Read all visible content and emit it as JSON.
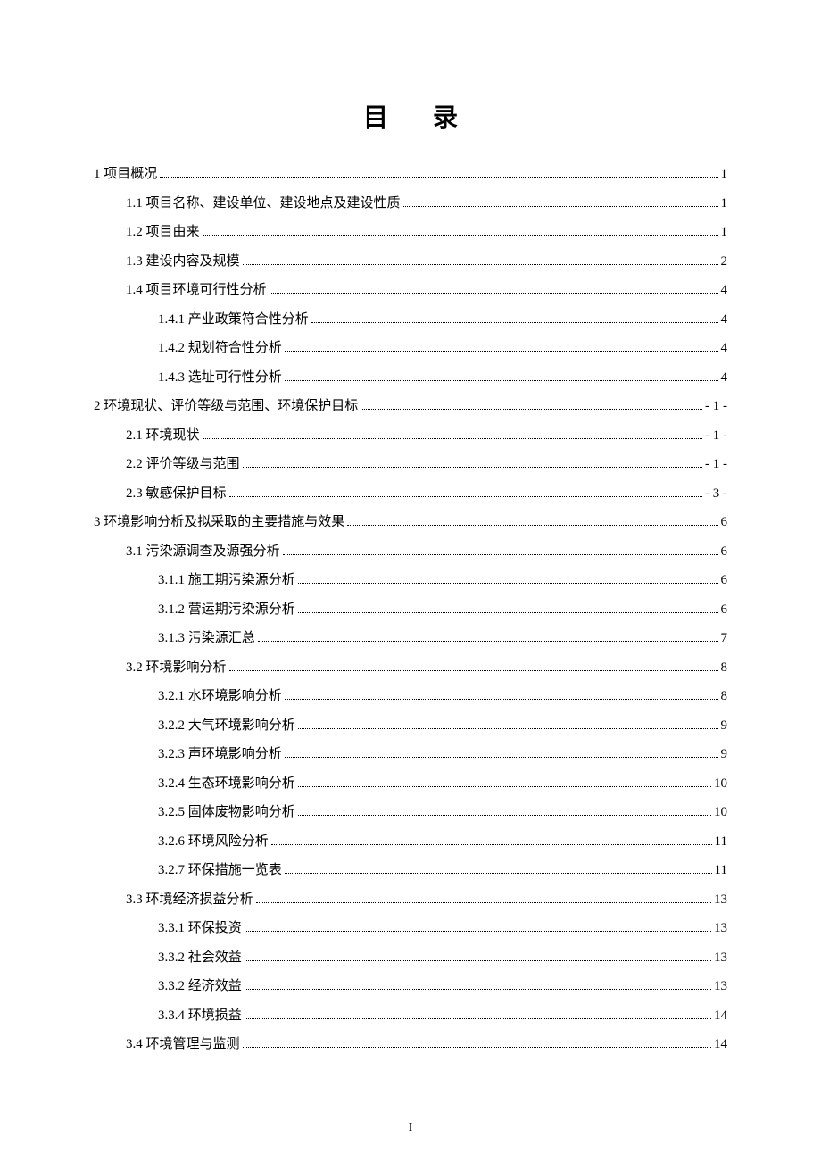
{
  "title": "目录",
  "footer_page": "I",
  "toc": [
    {
      "level": 0,
      "label": "1   项目概况",
      "page": "1"
    },
    {
      "level": 1,
      "label": "1.1  项目名称、建设单位、建设地点及建设性质",
      "page": "1"
    },
    {
      "level": 1,
      "label": "1.2  项目由来",
      "page": "1"
    },
    {
      "level": 1,
      "label": "1.3  建设内容及规模",
      "page": "2"
    },
    {
      "level": 1,
      "label": "1.4  项目环境可行性分析",
      "page": "4"
    },
    {
      "level": 2,
      "label": "1.4.1  产业政策符合性分析",
      "page": "4"
    },
    {
      "level": 2,
      "label": "1.4.2  规划符合性分析",
      "page": "4"
    },
    {
      "level": 2,
      "label": "1.4.3  选址可行性分析",
      "page": "4"
    },
    {
      "level": 0,
      "label": "2   环境现状、评价等级与范围、环境保护目标",
      "page": "- 1 -"
    },
    {
      "level": 1,
      "label": "2.1  环境现状",
      "page": "- 1 -"
    },
    {
      "level": 1,
      "label": "2.2  评价等级与范围",
      "page": "- 1 -"
    },
    {
      "level": 1,
      "label": "2.3  敏感保护目标",
      "page": "- 3 -"
    },
    {
      "level": 0,
      "label": "3 环境影响分析及拟采取的主要措施与效果",
      "page": "6"
    },
    {
      "level": 1,
      "label": "3.1  污染源调查及源强分析",
      "page": "6"
    },
    {
      "level": 2,
      "label": "3.1.1  施工期污染源分析",
      "page": "6"
    },
    {
      "level": 2,
      "label": "3.1.2  营运期污染源分析",
      "page": "6"
    },
    {
      "level": 2,
      "label": "3.1.3  污染源汇总",
      "page": "7"
    },
    {
      "level": 1,
      "label": "3.2 环境影响分析",
      "page": "8"
    },
    {
      "level": 2,
      "label": "3.2.1 水环境影响分析",
      "page": "8"
    },
    {
      "level": 2,
      "label": "3.2.2 大气环境影响分析",
      "page": "9"
    },
    {
      "level": 2,
      "label": "3.2.3  声环境影响分析",
      "page": "9"
    },
    {
      "level": 2,
      "label": "3.2.4  生态环境影响分析",
      "page": "10"
    },
    {
      "level": 2,
      "label": "3.2.5  固体废物影响分析",
      "page": "10"
    },
    {
      "level": 2,
      "label": "3.2.6  环境风险分析",
      "page": "11"
    },
    {
      "level": 2,
      "label": "3.2.7  环保措施一览表",
      "page": "11"
    },
    {
      "level": 1,
      "label": "3.3  环境经济损益分析",
      "page": "13"
    },
    {
      "level": 2,
      "label": "3.3.1  环保投资",
      "page": "13"
    },
    {
      "level": 2,
      "label": "3.3.2 社会效益",
      "page": "13"
    },
    {
      "level": 2,
      "label": "3.3.2  经济效益",
      "page": "13"
    },
    {
      "level": 2,
      "label": "3.3.4  环境损益",
      "page": "14"
    },
    {
      "level": 1,
      "label": "3.4  环境管理与监测",
      "page": "14"
    }
  ]
}
